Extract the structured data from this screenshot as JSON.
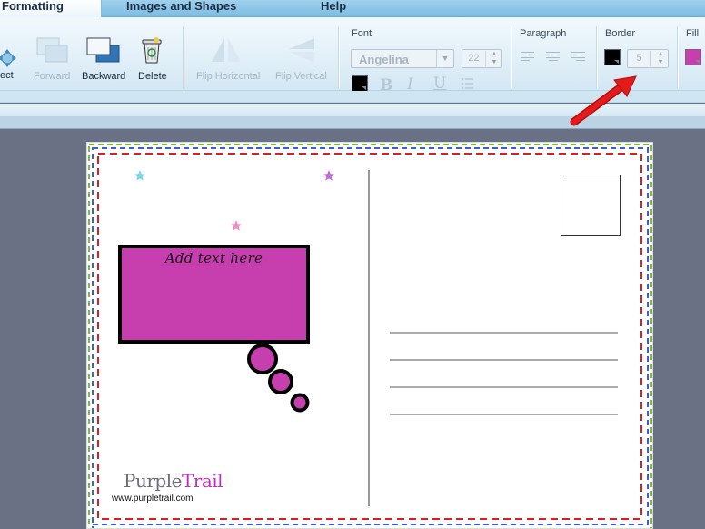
{
  "tabs": [
    {
      "label": "Formatting",
      "active": true
    },
    {
      "label": "Images and Shapes",
      "active": false
    },
    {
      "label": "Help",
      "active": false
    }
  ],
  "toolbar": {
    "select_label": "ect",
    "forward_label": "Forward",
    "backward_label": "Backward",
    "delete_label": "Delete",
    "flip_horizontal_label": "Flip Horizontal",
    "flip_vertical_label": "Flip Vertical",
    "font_group": "Font",
    "font_name": "Angelina",
    "font_size": "22",
    "paragraph_group": "Paragraph",
    "border_group": "Border",
    "border_width": "5",
    "fill_group": "Fill",
    "font_color": "#000000",
    "border_color": "#000000",
    "fill_color": "#c73fae"
  },
  "postcard": {
    "speech_text": "Add text here",
    "bubble_fill": "#c73fae",
    "logo_part1": "Purple",
    "logo_part2": "Trail",
    "logo_url": "www.purpletrail.com"
  }
}
